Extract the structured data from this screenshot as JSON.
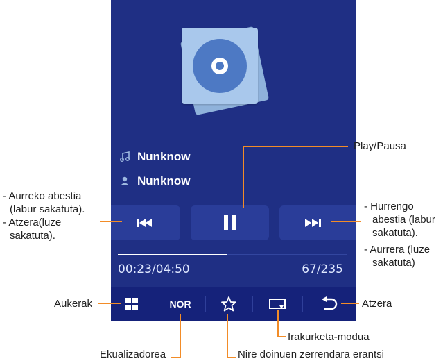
{
  "track": {
    "title": "Nunknow",
    "artist": "Nunknow"
  },
  "playback": {
    "time": "00:23/04:50",
    "counter": "67/235",
    "progress_fraction": 0.48
  },
  "toolbar": {
    "eq_label": "NOR"
  },
  "callouts": {
    "play_pause": "Play/Pausa",
    "prev_1": "- Aurreko abestia",
    "prev_2": "(labur sakatuta).",
    "prev_3": "- Atzera(luze",
    "prev_4": "sakatuta).",
    "next_1": "- Hurrengo",
    "next_2": "abestia (labur",
    "next_3": "sakatuta).",
    "next_4": "- Aurrera (luze",
    "next_5": "sakatuta)",
    "options": "Aukerak",
    "back": "Atzera",
    "playmode": "Irakurketa-modua",
    "equalizer": "Ekualizadorea",
    "favorites": "Nire doinuen zerrendara erantsi"
  },
  "colors": {
    "screen": "#1f2f84",
    "toolbar": "#15227a",
    "callout_line": "#f28c28"
  }
}
